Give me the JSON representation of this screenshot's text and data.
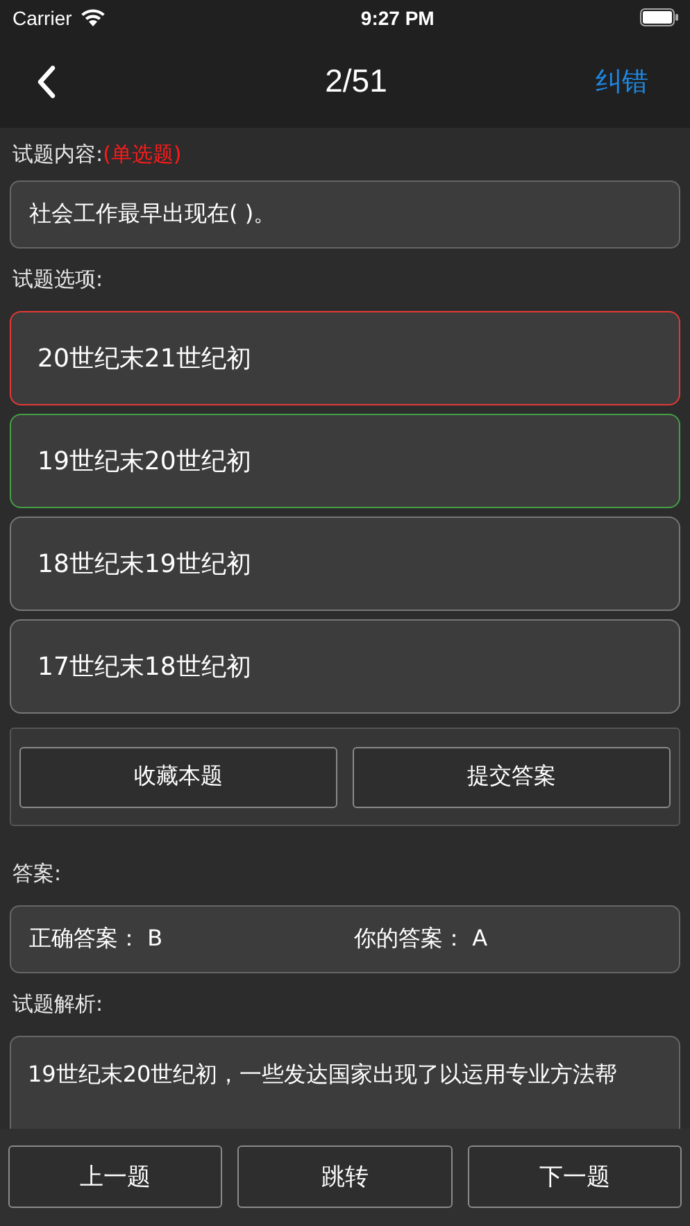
{
  "status_bar": {
    "carrier": "Carrier",
    "time": "9:27 PM"
  },
  "nav": {
    "title": "2/51",
    "action": "纠错"
  },
  "question": {
    "label": "试题内容:",
    "type": "(单选题)",
    "text": "社会工作最早出现在(   )。"
  },
  "options_label": "试题选项:",
  "options": [
    {
      "text": "20世纪末21世纪初",
      "selected": true,
      "correct": false
    },
    {
      "text": "19世纪末20世纪初",
      "selected": false,
      "correct": true
    },
    {
      "text": "18世纪末19世纪初",
      "selected": false,
      "correct": false
    },
    {
      "text": "17世纪末18世纪初",
      "selected": false,
      "correct": false
    }
  ],
  "actions": [
    "收藏本题",
    "提交答案"
  ],
  "answer": {
    "label": "答案:",
    "correct_label": "正确答案：",
    "correct_value": "B",
    "yours_label": "你的答案：",
    "yours_value": "A"
  },
  "explanation": {
    "label": "试题解析:",
    "text": "19世纪末20世纪初，一些发达国家出现了以运用专业方法帮"
  },
  "bottom_buttons": [
    "上一题",
    "跳转",
    "下一题"
  ]
}
